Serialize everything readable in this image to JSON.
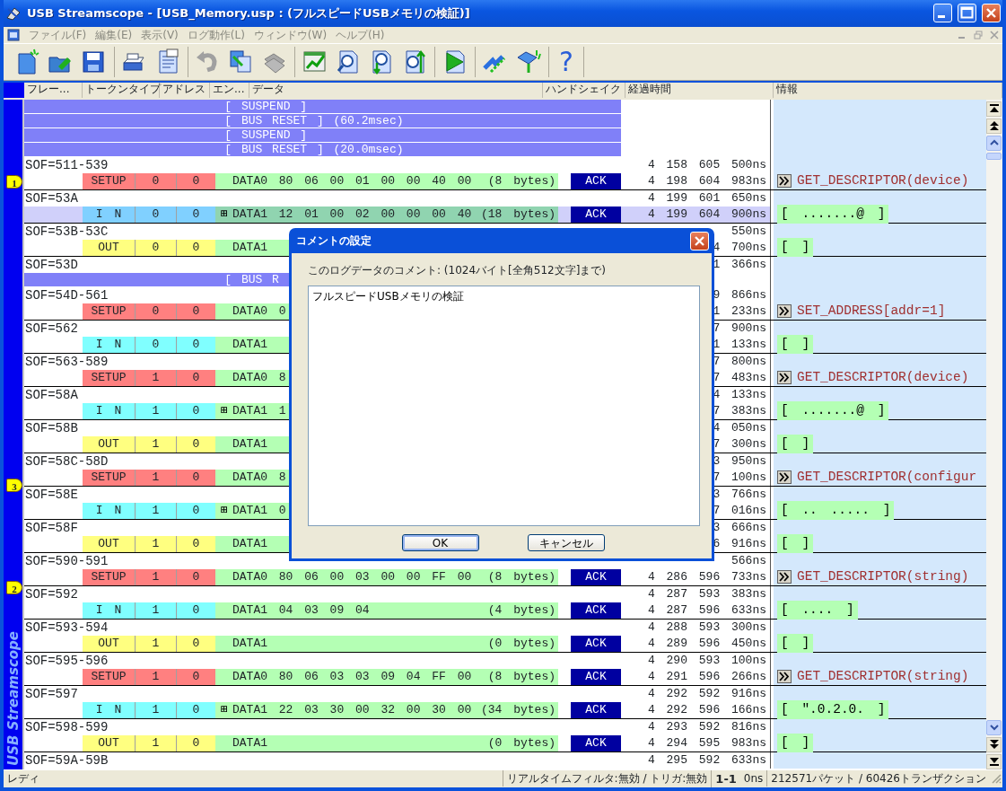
{
  "window": {
    "title": "USB Streamscope - [USB_Memory.usp : (フルスピードUSBメモリの検証)]"
  },
  "menu": [
    {
      "label": "ファイル(F)",
      "disabled": true
    },
    {
      "label": "編集(E)",
      "disabled": true
    },
    {
      "label": "表示(V)",
      "disabled": true
    },
    {
      "label": "ログ動作(L)",
      "disabled": true
    },
    {
      "label": "ウィンドウ(W)",
      "disabled": true
    },
    {
      "label": "ヘルプ(H)",
      "disabled": true
    }
  ],
  "toolbar": {
    "help_glyph": "?"
  },
  "columns": [
    "フレー...",
    "トークンタイプ",
    "アドレス",
    "エン...",
    "データ",
    "ハンドシェイク",
    "経過時間",
    "情報"
  ],
  "records": [
    {
      "kind": "event",
      "text": "[ SUSPEND ]"
    },
    {
      "kind": "event",
      "text": "[ BUS RESET ] (60.2msec)"
    },
    {
      "kind": "event",
      "text": "[ SUSPEND ]"
    },
    {
      "kind": "event",
      "text": "[ BUS RESET ] (20.0msec)"
    },
    {
      "kind": "transaction",
      "frame": "SOF=511-539",
      "frame_time": "4 158 605 500ns",
      "marker": "1",
      "selected": false,
      "packet": {
        "token": "SETUP",
        "kind": "setup",
        "addr": "0",
        "endp": "0",
        "data": "DATA0 80 06 00 01 00 00 40 00",
        "size": "(8 bytes)",
        "handshake": "ACK",
        "time": "4 198 604 983ns"
      },
      "info": {
        "kind": "request",
        "text": "GET_DESCRIPTOR(device)"
      }
    },
    {
      "kind": "transaction",
      "frame": "SOF=53A",
      "frame_time": "4 199 601 650ns",
      "selected": true,
      "packet": {
        "token": "I N",
        "kind": "in",
        "addr": "0",
        "endp": "0",
        "expander": "⊞",
        "data": "DATA1 12 01 00 02 00 00 00 40",
        "size": "(18 bytes)",
        "handshake": "ACK",
        "time": "4 199 604 900ns"
      },
      "info": {
        "kind": "payload",
        "text": "[ .......@ ]"
      }
    },
    {
      "kind": "transaction",
      "frame": "SOF=53B-53C",
      "frame_time": "550ns",
      "selected": false,
      "packet": {
        "token": "OUT",
        "kind": "out",
        "addr": "0",
        "endp": "0",
        "data": "DATA1",
        "time": "4 700ns"
      },
      "info": {
        "kind": "payload",
        "text": "[ ]"
      }
    },
    {
      "kind": "transaction",
      "frame": "SOF=53D",
      "frame_time": "1 366ns"
    },
    {
      "kind": "event",
      "text": "[ BUS R"
    },
    {
      "kind": "transaction",
      "frame": "SOF=54D-561",
      "frame_time": "9 866ns",
      "selected": false,
      "packet": {
        "token": "SETUP",
        "kind": "setup",
        "addr": "0",
        "endp": "0",
        "data": "DATA0 0",
        "time": "1 233ns"
      },
      "info": {
        "kind": "request",
        "text": "SET_ADDRESS[addr=1]"
      }
    },
    {
      "kind": "transaction",
      "frame": "SOF=562",
      "frame_time": "7 900ns",
      "selected": false,
      "packet": {
        "token": "I N",
        "kind": "in",
        "addr": "0",
        "endp": "0",
        "data": "DATA1",
        "time": "1 133ns"
      },
      "info": {
        "kind": "payload",
        "text": "[ ]"
      }
    },
    {
      "kind": "transaction",
      "frame": "SOF=563-589",
      "frame_time": "7 800ns",
      "selected": false,
      "packet": {
        "token": "SETUP",
        "kind": "setup",
        "addr": "1",
        "endp": "0",
        "data": "DATA0 8",
        "time": "7 483ns"
      },
      "info": {
        "kind": "request",
        "text": "GET_DESCRIPTOR(device)"
      }
    },
    {
      "kind": "transaction",
      "frame": "SOF=58A",
      "frame_time": "4 133ns",
      "selected": false,
      "packet": {
        "token": "I N",
        "kind": "in",
        "addr": "1",
        "endp": "0",
        "expander": "⊞",
        "data": "DATA1 1",
        "time": "7 383ns"
      },
      "info": {
        "kind": "payload",
        "text": "[ .......@ ]"
      }
    },
    {
      "kind": "transaction",
      "frame": "SOF=58B",
      "frame_time": "4 050ns",
      "selected": false,
      "packet": {
        "token": "OUT",
        "kind": "out",
        "addr": "1",
        "endp": "0",
        "data": "DATA1",
        "time": "7 300ns"
      },
      "info": {
        "kind": "payload",
        "text": "[ ]"
      }
    },
    {
      "kind": "transaction",
      "frame": "SOF=58C-58D",
      "frame_time": "3 950ns",
      "marker": "3",
      "selected": false,
      "packet": {
        "token": "SETUP",
        "kind": "setup",
        "addr": "1",
        "endp": "0",
        "data": "DATA0 8",
        "time": "7 100ns"
      },
      "info": {
        "kind": "request",
        "text": "GET_DESCRIPTOR(configur"
      }
    },
    {
      "kind": "transaction",
      "frame": "SOF=58E",
      "frame_time": "3 766ns",
      "selected": false,
      "packet": {
        "token": "I N",
        "kind": "in",
        "addr": "1",
        "endp": "0",
        "expander": "⊞",
        "data": "DATA1 0",
        "time": "7 016ns"
      },
      "info": {
        "kind": "payload",
        "text": "[ .. ..... ]"
      }
    },
    {
      "kind": "transaction",
      "frame": "SOF=58F",
      "frame_time": "3 666ns",
      "selected": false,
      "packet": {
        "token": "OUT",
        "kind": "out",
        "addr": "1",
        "endp": "0",
        "data": "DATA1",
        "time": "6 916ns"
      },
      "info": {
        "kind": "payload",
        "text": "[ ]"
      }
    },
    {
      "kind": "transaction",
      "frame": "SOF=590-591",
      "frame_time": "566ns",
      "marker": "2",
      "selected": false,
      "packet": {
        "token": "SETUP",
        "kind": "setup",
        "addr": "1",
        "endp": "0",
        "data": "DATA0 80 06 00 03 00 00 FF 00",
        "size": "(8 bytes)",
        "handshake": "ACK",
        "time": "4 286 596 733ns"
      },
      "info": {
        "kind": "request",
        "text": "GET_DESCRIPTOR(string)"
      }
    },
    {
      "kind": "transaction",
      "frame": "SOF=592",
      "frame_time": "4 287 593 383ns",
      "selected": false,
      "packet": {
        "token": "I N",
        "kind": "in",
        "addr": "1",
        "endp": "0",
        "data": "DATA1 04 03 09 04",
        "size": "(4 bytes)",
        "handshake": "ACK",
        "time": "4 287 596 633ns"
      },
      "info": {
        "kind": "payload",
        "text": "[ .... ]"
      }
    },
    {
      "kind": "transaction",
      "frame": "SOF=593-594",
      "frame_time": "4 288 593 300ns",
      "selected": false,
      "packet": {
        "token": "OUT",
        "kind": "out",
        "addr": "1",
        "endp": "0",
        "data": "DATA1",
        "size": "(0 bytes)",
        "handshake": "ACK",
        "time": "4 289 596 450ns"
      },
      "info": {
        "kind": "payload",
        "text": "[ ]"
      }
    },
    {
      "kind": "transaction",
      "frame": "SOF=595-596",
      "frame_time": "4 290 593 100ns",
      "selected": false,
      "packet": {
        "token": "SETUP",
        "kind": "setup",
        "addr": "1",
        "endp": "0",
        "data": "DATA0 80 06 03 03 09 04 FF 00",
        "size": "(8 bytes)",
        "handshake": "ACK",
        "time": "4 291 596 266ns"
      },
      "info": {
        "kind": "request",
        "text": "GET_DESCRIPTOR(string)"
      }
    },
    {
      "kind": "transaction",
      "frame": "SOF=597",
      "frame_time": "4 292 592 916ns",
      "selected": false,
      "packet": {
        "token": "I N",
        "kind": "in",
        "addr": "1",
        "endp": "0",
        "expander": "⊞",
        "data": "DATA1 22 03 30 00 32 00 30 00",
        "size": "(34 bytes)",
        "handshake": "ACK",
        "time": "4 292 596 166ns"
      },
      "info": {
        "kind": "payload",
        "text": "[ \".0.2.0. ]"
      }
    },
    {
      "kind": "transaction",
      "frame": "SOF=598-599",
      "frame_time": "4 293 592 816ns",
      "selected": false,
      "packet": {
        "token": "OUT",
        "kind": "out",
        "addr": "1",
        "endp": "0",
        "data": "DATA1",
        "size": "(0 bytes)",
        "handshake": "ACK",
        "time": "4 294 595 983ns"
      },
      "info": {
        "kind": "payload",
        "text": "[ ]"
      }
    },
    {
      "kind": "transaction",
      "frame": "SOF=59A-59B",
      "frame_time": "4 295 592 633ns"
    }
  ],
  "side_logo": "USB Streamscope",
  "dialog": {
    "title": "コメントの設定",
    "label": "このログデータのコメント: (1024バイト[全角512文字]まで)",
    "value": "フルスピードUSBメモリの検証",
    "buttons": [
      {
        "label": "OK",
        "focused": true
      },
      {
        "label": "キャンセル",
        "focused": false
      }
    ]
  },
  "status_bar": {
    "state": "レディ",
    "filter": "リアルタイムフィルタ:無効 / トリガ:無効",
    "range": "1-1",
    "delta": "0ns",
    "counts": "212571パケット / 60426トランザクション"
  }
}
